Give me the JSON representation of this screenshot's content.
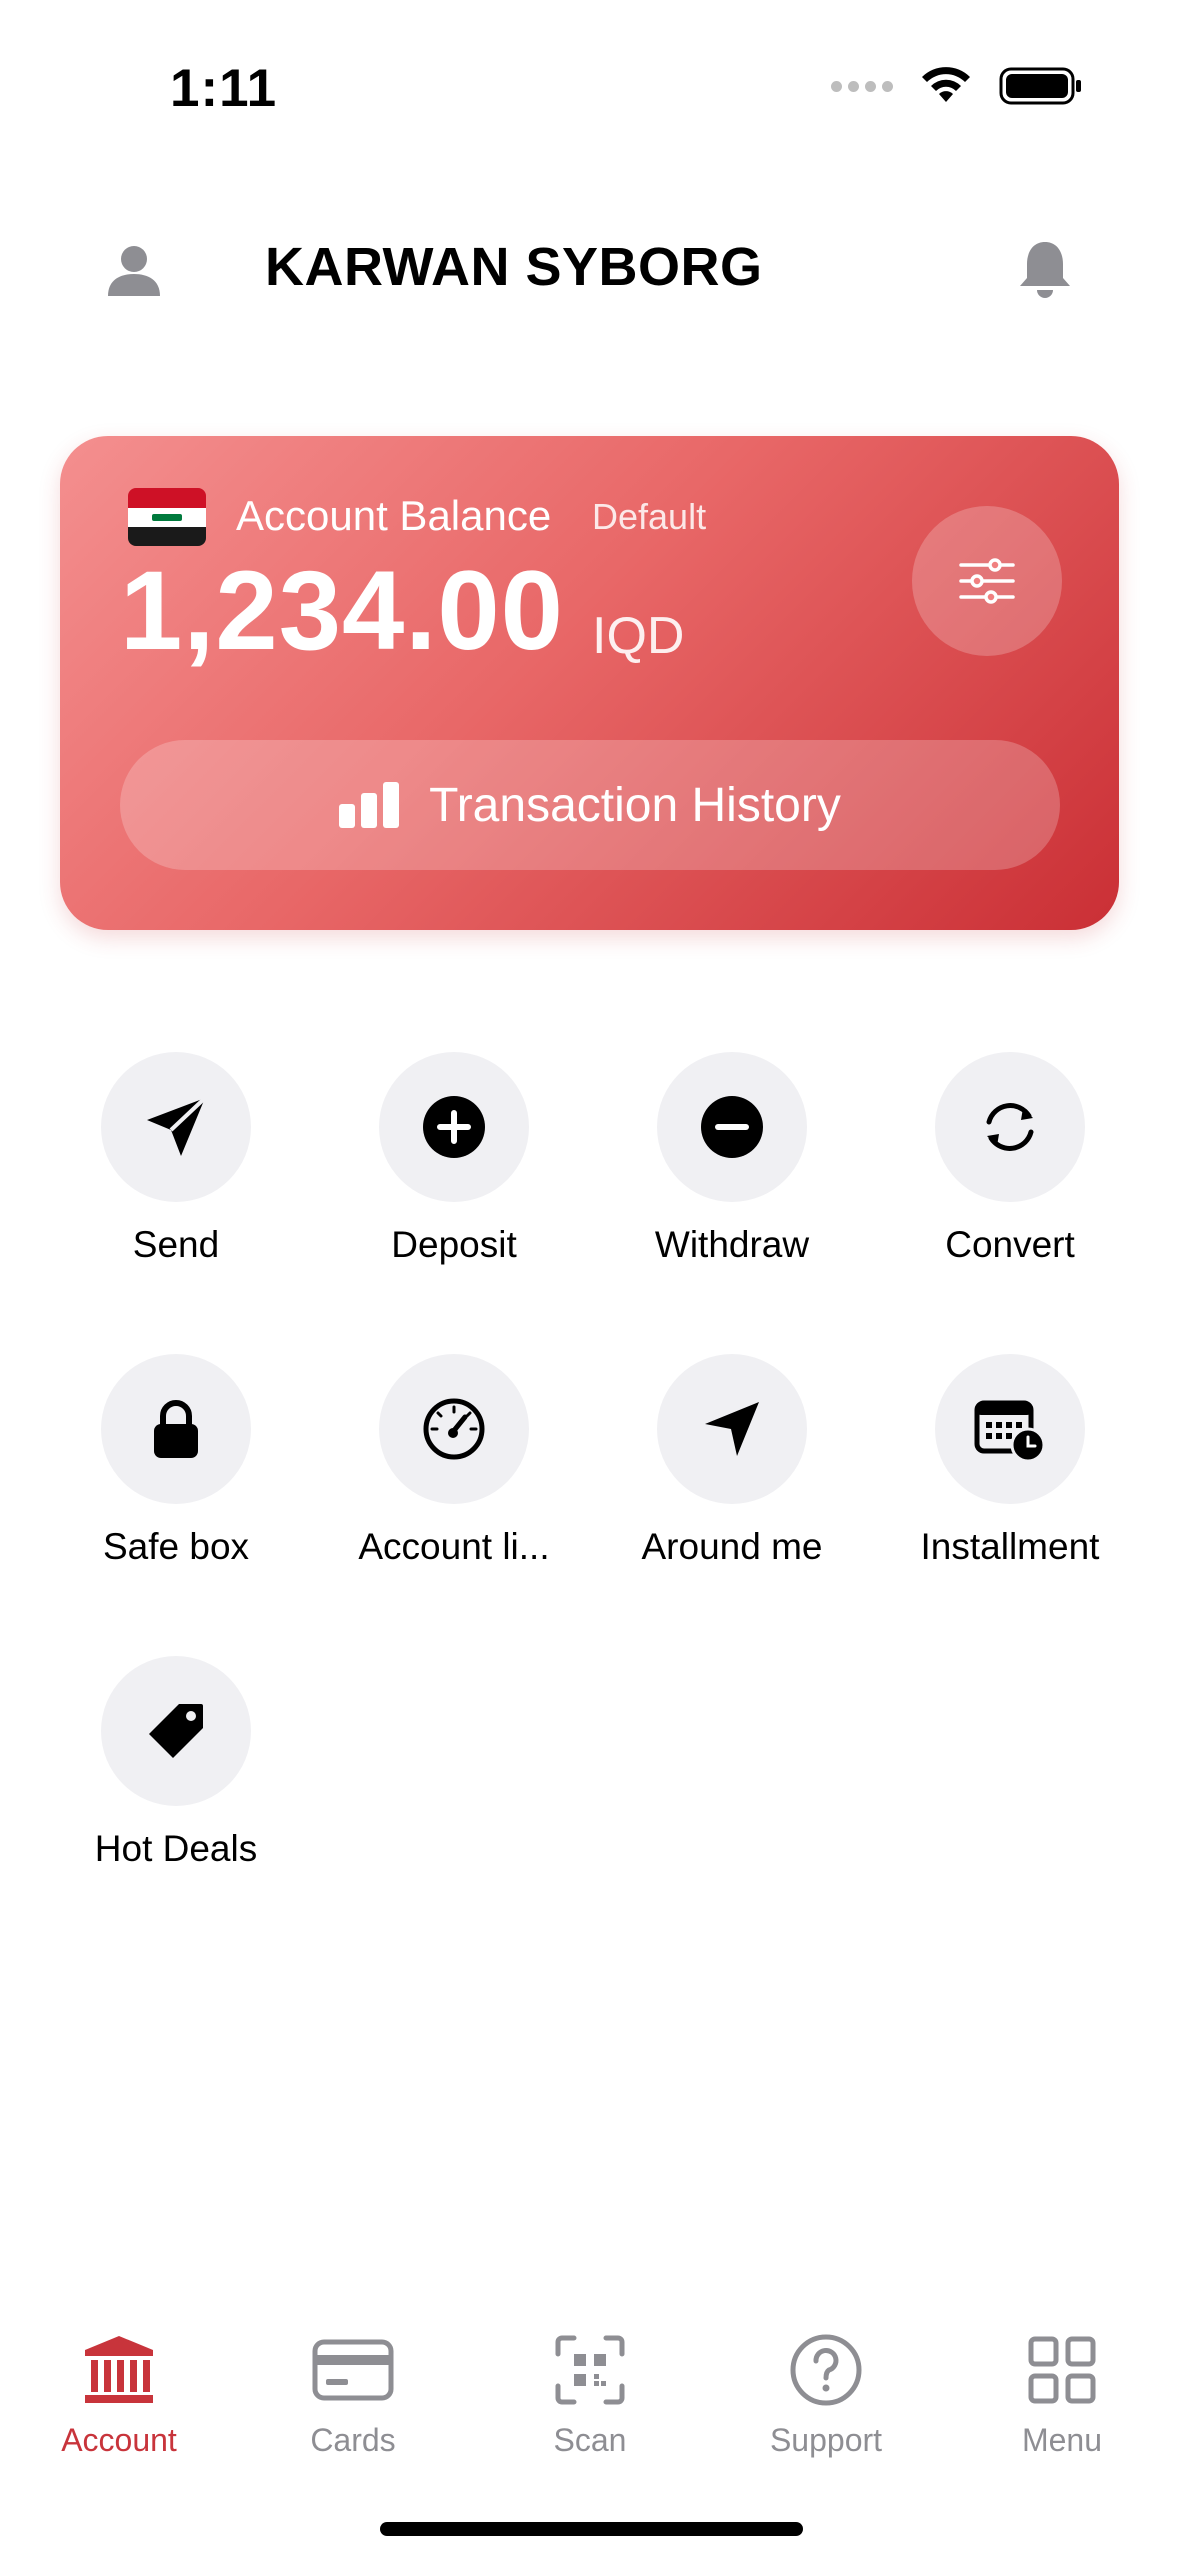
{
  "status_bar": {
    "time": "1:11"
  },
  "header": {
    "title": "KARWAN SYBORG"
  },
  "balance_card": {
    "label": "Account Balance",
    "badge": "Default",
    "amount": "1,234.00",
    "currency": "IQD",
    "history_button": "Transaction History",
    "colors": {
      "gradient_start": "#f48f8f",
      "gradient_end": "#ca2f35"
    }
  },
  "actions": [
    {
      "label": "Send",
      "icon": "send-icon"
    },
    {
      "label": "Deposit",
      "icon": "plus-circle-icon"
    },
    {
      "label": "Withdraw",
      "icon": "minus-circle-icon"
    },
    {
      "label": "Convert",
      "icon": "convert-icon"
    },
    {
      "label": "Safe box",
      "icon": "lock-icon"
    },
    {
      "label": "Account li...",
      "icon": "gauge-icon"
    },
    {
      "label": "Around me",
      "icon": "location-arrow-icon"
    },
    {
      "label": "Installment",
      "icon": "calendar-clock-icon"
    },
    {
      "label": "Hot Deals",
      "icon": "tag-icon"
    }
  ],
  "tab_bar": {
    "active": "Account",
    "accent_color": "#c8343b",
    "tabs": [
      {
        "label": "Account",
        "icon": "bank-icon"
      },
      {
        "label": "Cards",
        "icon": "card-icon"
      },
      {
        "label": "Scan",
        "icon": "qr-scan-icon"
      },
      {
        "label": "Support",
        "icon": "help-circle-icon"
      },
      {
        "label": "Menu",
        "icon": "grid-icon"
      }
    ]
  }
}
